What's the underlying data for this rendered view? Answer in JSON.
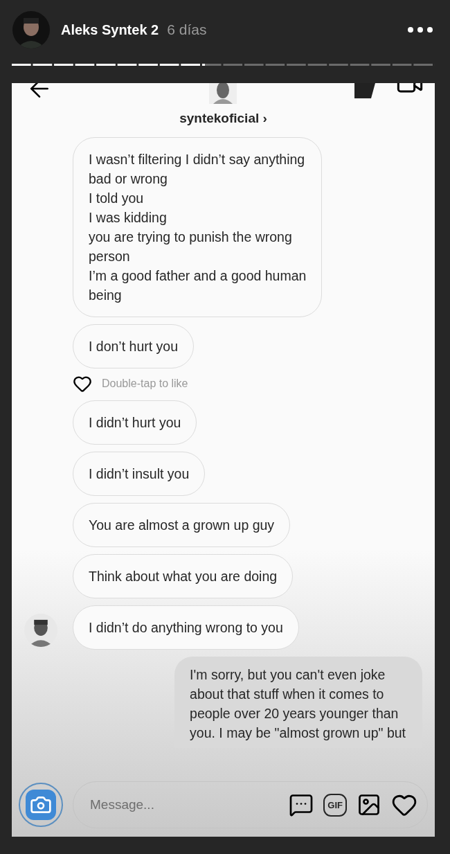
{
  "story": {
    "author": "Aleks Syntek 2",
    "age": "6 días"
  },
  "progress": {
    "level": 0.456
  },
  "chat": {
    "username": "syntekoficial",
    "chevron": "›",
    "messages": [
      {
        "kind": "incoming",
        "text": "I wasn’t filtering I didn’t say anything\nbad or wrong\nI told you\nI was kidding\n you are trying to punish the wrong\nperson\nI’m a good father and a good human\nbeing",
        "avatar": false
      },
      {
        "kind": "incoming",
        "text": "I don’t hurt you",
        "avatar": false,
        "hint": "Double-tap to like"
      },
      {
        "kind": "incoming",
        "text": "I didn’t hurt you",
        "avatar": false
      },
      {
        "kind": "incoming",
        "text": "I didn’t insult you",
        "avatar": false
      },
      {
        "kind": "incoming",
        "text": "You are almost a grown up guy",
        "avatar": false
      },
      {
        "kind": "incoming",
        "text": "Think about what you are doing",
        "avatar": false
      },
      {
        "kind": "incoming",
        "text": "I didn’t do anything wrong to you",
        "avatar": true
      },
      {
        "kind": "outgoing",
        "text": "I'm sorry, but you can't even joke\nabout that stuff when it comes to\npeople over 20 years younger than\nyou.  I may be \"almost grown up\" but",
        "avatar": false
      }
    ],
    "composer": {
      "placeholder": "Message...",
      "gif": "GIF"
    }
  }
}
